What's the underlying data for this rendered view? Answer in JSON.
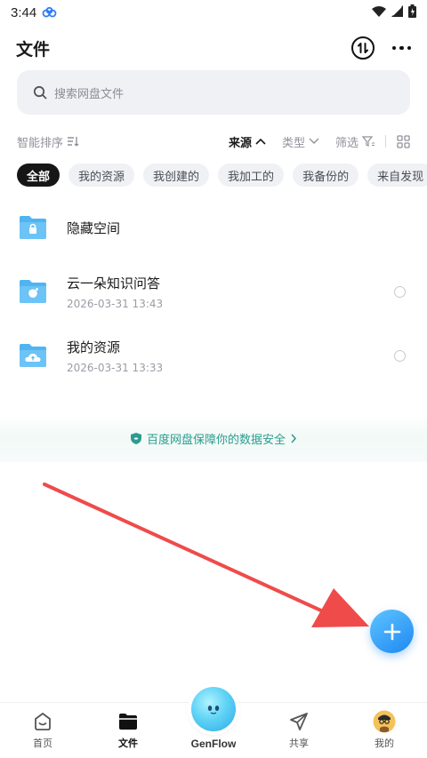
{
  "status_bar": {
    "time": "3:44"
  },
  "header": {
    "title": "文件"
  },
  "search": {
    "placeholder": "搜索网盘文件"
  },
  "sort_bar": {
    "sort_label": "智能排序",
    "options": [
      {
        "label": "来源",
        "active": true
      },
      {
        "label": "类型",
        "active": false
      },
      {
        "label": "筛选",
        "active": false
      }
    ]
  },
  "chips": [
    {
      "label": "全部",
      "active": true
    },
    {
      "label": "我的资源",
      "active": false
    },
    {
      "label": "我创建的",
      "active": false
    },
    {
      "label": "我加工的",
      "active": false
    },
    {
      "label": "我备份的",
      "active": false
    },
    {
      "label": "来自发现",
      "active": false
    }
  ],
  "files": [
    {
      "name": "隐藏空间",
      "date": "",
      "icon": "lock-folder-icon"
    },
    {
      "name": "云一朵知识问答",
      "date": "2026-03-31  13:43",
      "icon": "ai-folder-icon"
    },
    {
      "name": "我的资源",
      "date": "2026-03-31  13:33",
      "icon": "cloud-folder-icon"
    }
  ],
  "banner": {
    "text": "百度网盘保障你的数据安全"
  },
  "tabs": [
    {
      "label": "首页",
      "icon": "home-icon"
    },
    {
      "label": "文件",
      "icon": "folder-icon",
      "active": true
    },
    {
      "label": "GenFlow",
      "icon": "genflow-orb-icon"
    },
    {
      "label": "共享",
      "icon": "send-icon"
    },
    {
      "label": "我的",
      "icon": "avatar-icon"
    }
  ],
  "colors": {
    "accent": "#1e88f2",
    "folder": "#4fb4f2",
    "banner_text": "#2a9d8f",
    "annotation_arrow": "#ef4b4b"
  }
}
